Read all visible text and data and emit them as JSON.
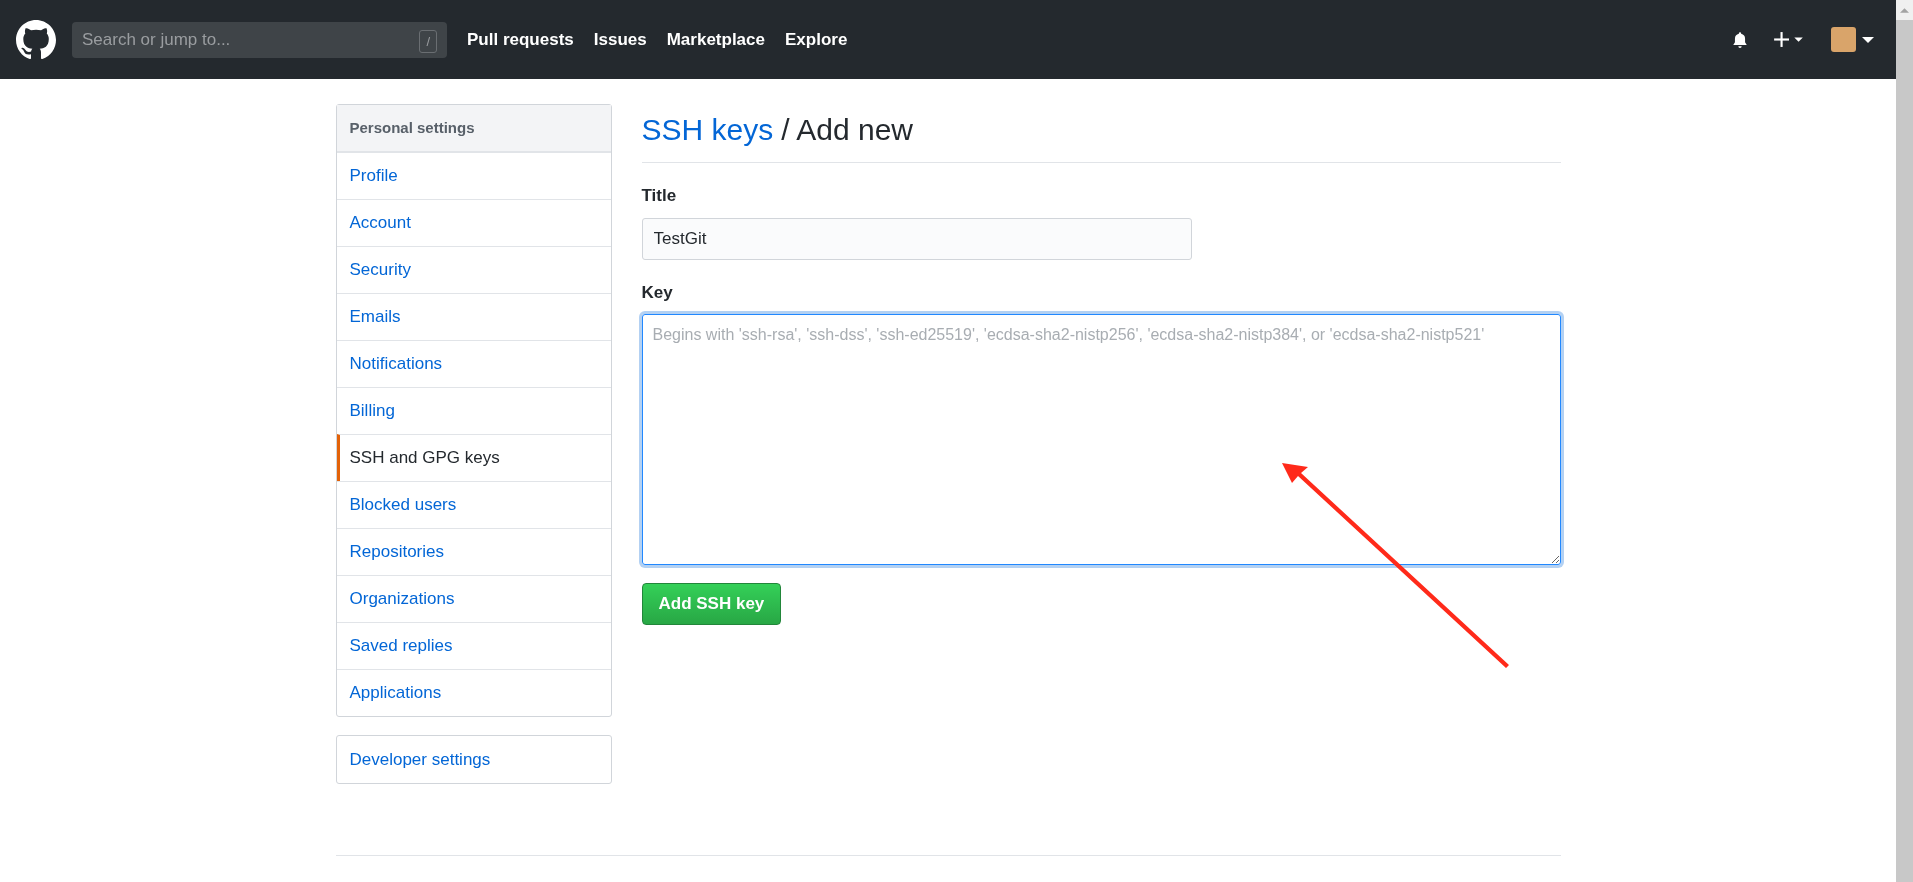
{
  "header": {
    "search": {
      "placeholder": "Search or jump to...",
      "shortcut": "/"
    },
    "nav": [
      "Pull requests",
      "Issues",
      "Marketplace",
      "Explore"
    ]
  },
  "sidebar": {
    "heading": "Personal settings",
    "items": [
      {
        "label": "Profile",
        "selected": false
      },
      {
        "label": "Account",
        "selected": false
      },
      {
        "label": "Security",
        "selected": false
      },
      {
        "label": "Emails",
        "selected": false
      },
      {
        "label": "Notifications",
        "selected": false
      },
      {
        "label": "Billing",
        "selected": false
      },
      {
        "label": "SSH and GPG keys",
        "selected": true
      },
      {
        "label": "Blocked users",
        "selected": false
      },
      {
        "label": "Repositories",
        "selected": false
      },
      {
        "label": "Organizations",
        "selected": false
      },
      {
        "label": "Saved replies",
        "selected": false
      },
      {
        "label": "Applications",
        "selected": false
      }
    ],
    "developer": "Developer settings"
  },
  "page": {
    "breadcrumb_link": "SSH keys",
    "title": "/ Add new",
    "fields": [
      {
        "label": "Title",
        "kind": "input",
        "value": "TestGit"
      },
      {
        "label": "Key",
        "kind": "textarea",
        "placeholder": "Begins with 'ssh-rsa', 'ssh-dss', 'ssh-ed25519', 'ecdsa-sha2-nistp256', 'ecdsa-sha2-nistp384', or 'ecdsa-sha2-nistp521'"
      }
    ],
    "submit": "Add SSH key"
  }
}
